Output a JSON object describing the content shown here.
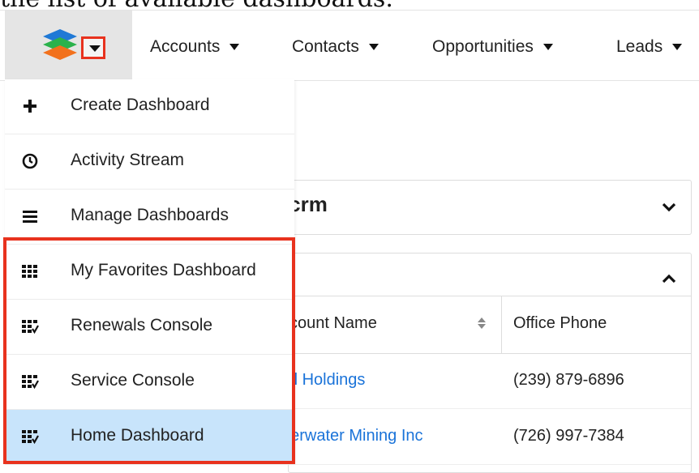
{
  "caption": "the list of available dashboards.",
  "nav": {
    "items": [
      {
        "label": "Accounts"
      },
      {
        "label": "Contacts"
      },
      {
        "label": "Opportunities"
      },
      {
        "label": "Leads"
      }
    ]
  },
  "background": {
    "panel_title": "rcrm",
    "columns": [
      "ccount Name",
      "Office Phone"
    ],
    "rows": [
      {
        "name": "ell Holdings",
        "phone": "(239) 879-6896"
      },
      {
        "name": "derwater Mining Inc",
        "phone": "(726) 997-7384"
      }
    ]
  },
  "menu": {
    "items": [
      {
        "label": "Create Dashboard",
        "icon": "plus-icon"
      },
      {
        "label": "Activity Stream",
        "icon": "clock-icon"
      },
      {
        "label": "Manage Dashboards",
        "icon": "list-icon"
      },
      {
        "label": "My Favorites Dashboard",
        "icon": "grid-icon"
      },
      {
        "label": "Renewals Console",
        "icon": "grid-check-icon"
      },
      {
        "label": "Service Console",
        "icon": "grid-check-icon"
      },
      {
        "label": "Home Dashboard",
        "icon": "grid-check-icon",
        "active": true
      }
    ]
  },
  "colors": {
    "highlight": "#e8321e",
    "active_row": "#c8e4fb",
    "link": "#1a73d9"
  }
}
